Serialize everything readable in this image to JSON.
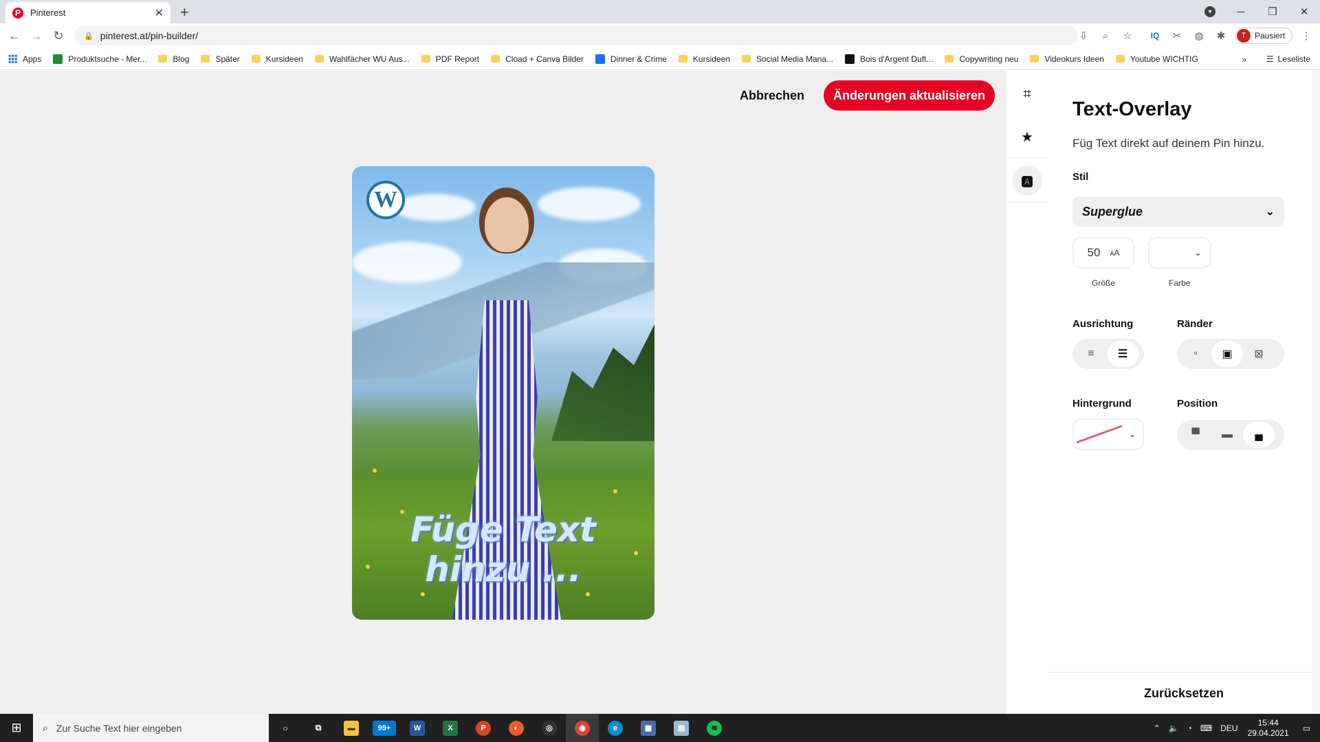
{
  "browser": {
    "tab_title": "Pinterest",
    "url": "pinterest.at/pin-builder/",
    "profile_label": "Pausiert",
    "profile_initial": "T",
    "bookmarks": [
      "Apps",
      "Produktsuche - Mer...",
      "Blog",
      "Später",
      "Kursideen",
      "Wahlfächer WU Aus...",
      "PDF Report",
      "Cload + Canva Bilder",
      "Dinner & Crime",
      "Kursideen",
      "Social Media Mana...",
      "Bois d'Argent Duft...",
      "Copywriting neu",
      "Videokurs Ideen",
      "Youtube WICHTIG"
    ],
    "reading_list": "Leseliste"
  },
  "pin_builder": {
    "cancel_label": "Abbrechen",
    "update_label": "Änderungen aktualisieren",
    "overlay_text": "Füge Text hinzu ..."
  },
  "panel": {
    "title": "Text-Overlay",
    "subtitle": "Füg Text direkt auf deinem Pin hinzu.",
    "style_label": "Stil",
    "style_value": "Superglue",
    "size_value": "50",
    "size_caption": "Größe",
    "color_caption": "Farbe",
    "alignment_label": "Ausrichtung",
    "borders_label": "Ränder",
    "background_label": "Hintergrund",
    "position_label": "Position",
    "reset_label": "Zurücksetzen"
  },
  "taskbar": {
    "search_placeholder": "Zur Suche Text hier eingeben",
    "mail_badge": "99+",
    "language": "DEU",
    "time": "15:44",
    "date": "29.04.2021"
  },
  "colors": {
    "pinterest_red": "#e60023",
    "wordpress_blue": "#21759b"
  }
}
